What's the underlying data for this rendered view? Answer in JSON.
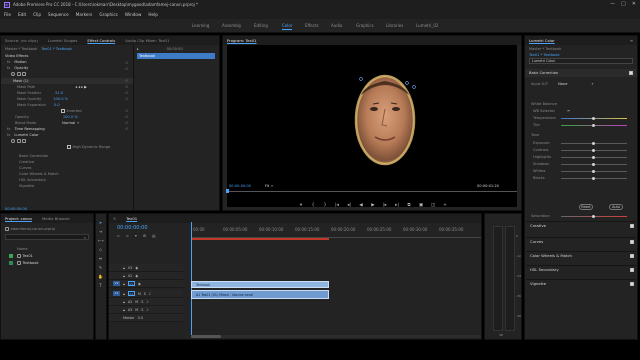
{
  "window": {
    "title": "Adobe Premiere Pro CC 2018 - C:\\Users\\rokmarr\\Desktop\\mygood\\adamfamej-canon.prproj *",
    "logo_text": "Pr",
    "controls": [
      "—",
      "□",
      "✕"
    ]
  },
  "menu": [
    "File",
    "Edit",
    "Clip",
    "Sequence",
    "Markers",
    "Graphics",
    "Window",
    "Help"
  ],
  "workspaces": [
    "Learning",
    "Assembly",
    "Editing",
    "Color",
    "Effects",
    "Audio",
    "Graphics",
    "Libraries",
    "Lumetri_02"
  ],
  "active_workspace": "Color",
  "effect_controls": {
    "tabs": [
      "Source: (no clips)",
      "Lumetri Scopes",
      "Effect Controls",
      "Audio Clip Mixer: Tex01"
    ],
    "master": "Master * Textbook",
    "clip": "Tex01 * Textbook",
    "timecode_top": "00:00:00",
    "clip_label": "Textbook",
    "section": "Video Effects",
    "motion": "Motion",
    "opacity": "Opacity",
    "mask": "Mask (1)",
    "mask_path": "Mask Path",
    "mask_feather": "Mask Feather",
    "mask_feather_val": "51.0",
    "mask_opacity": "Mask Opacity",
    "mask_opacity_val": "100.0 %",
    "mask_expansion": "Mask Expansion",
    "mask_expansion_val": "0.0",
    "inverted": "Inverted",
    "opacity_label": "Opacity",
    "opacity_val": "100.0 %",
    "blend_label": "Blend Mode",
    "blend_val": "Normal",
    "time_remap": "Time Remapping",
    "lumetri": "Lumetri Color",
    "high_dr": "High Dynamic Range",
    "basic": "Basic Correction",
    "creative": "Creative",
    "curves": "Curves",
    "wheels": "Color Wheels & Match",
    "hsl": "HSL Secondary",
    "vignette": "Vignette",
    "timecode_bottom": "00:00:00:00"
  },
  "program": {
    "tab": "Program: Tex01",
    "timecode": "00:00:00:00",
    "fit": "Fit",
    "duration": "00:00:01:20",
    "transport": [
      "▾",
      "{",
      "}",
      "|◂",
      "◂|",
      "◀",
      "▶",
      "|▸",
      "▸|",
      "⧉",
      "▣",
      "◫",
      "+"
    ]
  },
  "project": {
    "tabs": [
      "Project: canon",
      "Media Browser"
    ],
    "file": "adamfamej-canon.prproj",
    "name_col": "Name",
    "items": [
      "Tex01",
      "Textbook"
    ],
    "item_colors": [
      "#3aa655",
      "#2e8b57"
    ]
  },
  "timeline": {
    "tab": "Tex01",
    "timecode": "00:00:00:00",
    "ruler": [
      "00:00",
      "00:00:05:00",
      "00:00:10:00",
      "00:00:15:00",
      "00:00:20:00",
      "00:00:25:00",
      "00:00:30:00",
      "00:00:35:00",
      "00:00:40:00"
    ],
    "tracks": [
      "V3",
      "V2",
      "V1",
      "A1",
      "A2",
      "A3"
    ],
    "source_labels": [
      "V1",
      "A1"
    ],
    "master": "Master",
    "master_val": "0.0",
    "clip_v2": "Textbook",
    "clip_v1": "Tex01",
    "clip_a1": "A1 Tex01 (V1) Mixed - Volume Level"
  },
  "meter_labels": [
    "0",
    "-12",
    "-24",
    "-36",
    "-48",
    "dB"
  ],
  "lumetri": {
    "tab": "Lumetri Color",
    "master": "Master * Textbook",
    "clip": "Tex01 * Textbook",
    "basic": "Basic Correction",
    "input_lut": "Input LUT",
    "input_lut_val": "None",
    "wb": "White Balance",
    "wb_sel": "WB Selector",
    "temperature": "Temperature",
    "tint": "Tint",
    "tone": "Tone",
    "tone_rows": [
      "Exposure",
      "Contrast",
      "Highlights",
      "Shadows",
      "Whites",
      "Blacks"
    ],
    "reset": "Reset",
    "auto": "Auto",
    "saturation": "Saturation",
    "sections": [
      "Creative",
      "Curves",
      "Color Wheels & Match",
      "HSL Secondary",
      "Vignette"
    ]
  }
}
